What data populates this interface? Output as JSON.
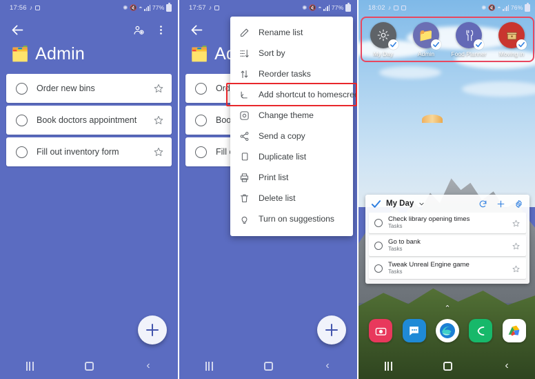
{
  "panel1": {
    "status": {
      "time": "17:56",
      "battery": "77%",
      "icons": [
        "music-note-icon",
        "screenshot-icon",
        "bluetooth-icon",
        "mute-icon",
        "wifi-icon",
        "signal-icon"
      ]
    },
    "appbar": {
      "back": "back-arrow-icon",
      "add_person": "add-person-icon",
      "overflow": "more-vertical-icon"
    },
    "list": {
      "emoji": "🗂️",
      "title": "Admin"
    },
    "tasks": [
      {
        "title": "Order new bins",
        "starred": false
      },
      {
        "title": "Book doctors appointment",
        "starred": false
      },
      {
        "title": "Fill out inventory form",
        "starred": false
      }
    ],
    "fab": "add-task-fab",
    "nav": {
      "recents": "recents-icon",
      "home": "home-icon",
      "back": "back-icon"
    }
  },
  "panel2": {
    "status": {
      "time": "17:57",
      "battery": "77%"
    },
    "list": {
      "emoji": "🗂️",
      "title": "Admin"
    },
    "tasks": [
      {
        "title": "Order new bins"
      },
      {
        "title": "Book doctors appointment"
      },
      {
        "title": "Fill out inventory form"
      }
    ],
    "menu": {
      "items": [
        {
          "label": "Rename list",
          "icon": "pencil-icon",
          "highlighted": false
        },
        {
          "label": "Sort by",
          "icon": "sort-icon",
          "highlighted": false
        },
        {
          "label": "Reorder tasks",
          "icon": "reorder-icon",
          "highlighted": false
        },
        {
          "label": "Add shortcut to homescreen",
          "icon": "add-shortcut-icon",
          "highlighted": true
        },
        {
          "label": "Change theme",
          "icon": "theme-icon",
          "highlighted": false
        },
        {
          "label": "Send a copy",
          "icon": "share-icon",
          "highlighted": false
        },
        {
          "label": "Duplicate list",
          "icon": "duplicate-icon",
          "highlighted": false
        },
        {
          "label": "Print list",
          "icon": "print-icon",
          "highlighted": false
        },
        {
          "label": "Delete list",
          "icon": "trash-icon",
          "highlighted": false
        },
        {
          "label": "Turn on suggestions",
          "icon": "lightbulb-icon",
          "highlighted": false
        }
      ],
      "highlight_color": "#e8272b"
    }
  },
  "panel3": {
    "status": {
      "time": "18:02",
      "battery": "76%"
    },
    "shortcuts": [
      {
        "label": "My Day",
        "icon": "sun-icon",
        "color": "#5f6368"
      },
      {
        "label": "Admin",
        "icon": "folder-icon",
        "color": "#6b6fb4"
      },
      {
        "label": "Food Planner",
        "icon": "cutlery-icon",
        "color": "#6369b6"
      },
      {
        "label": "Moving in",
        "icon": "box-icon",
        "color": "#c9352f"
      }
    ],
    "shortcut_highlight_color": "#e8475f",
    "widget": {
      "title": "My Day",
      "chevron": "chevron-down-icon",
      "actions": [
        "refresh-icon",
        "add-icon",
        "settings-icon"
      ],
      "accent": "#2f7fe0",
      "tasks": [
        {
          "title": "Check library opening times",
          "list": "Tasks"
        },
        {
          "title": "Go to bank",
          "list": "Tasks"
        },
        {
          "title": "Tweak Unreal Engine game",
          "list": "Tasks"
        }
      ]
    },
    "page_arrow": "⌃",
    "dock": [
      {
        "name": "camera-app-icon",
        "color": "#e8385c"
      },
      {
        "name": "messages-app-icon",
        "color": "#1f8ad6"
      },
      {
        "name": "edge-browser-icon",
        "color": "#ffffff"
      },
      {
        "name": "phone-app-icon",
        "color": "#17b86a"
      },
      {
        "name": "maps-app-icon",
        "color": "#ffffff"
      }
    ]
  },
  "theme": {
    "app_background": "#5b6cc1",
    "card": "#ffffff",
    "accent_red": "#e8272b"
  }
}
